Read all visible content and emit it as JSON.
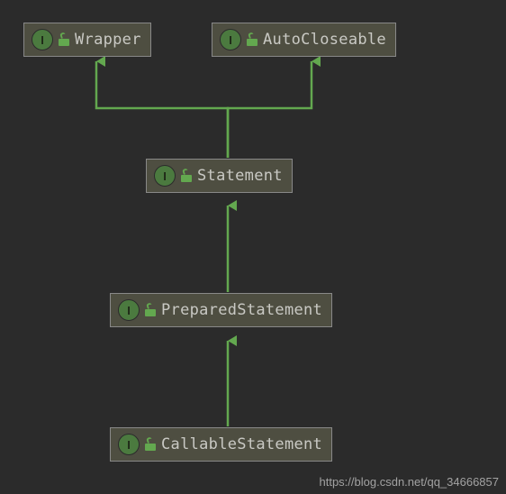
{
  "diagram": {
    "nodes": {
      "wrapper": {
        "label": "Wrapper",
        "badge": "I"
      },
      "autocloseable": {
        "label": "AutoCloseable",
        "badge": "I"
      },
      "statement": {
        "label": "Statement",
        "badge": "I"
      },
      "prepared": {
        "label": "PreparedStatement",
        "badge": "I"
      },
      "callable": {
        "label": "CallableStatement",
        "badge": "I"
      }
    },
    "edges": [
      {
        "from": "statement",
        "to": "wrapper"
      },
      {
        "from": "statement",
        "to": "autocloseable"
      },
      {
        "from": "prepared",
        "to": "statement"
      },
      {
        "from": "callable",
        "to": "prepared"
      }
    ]
  },
  "watermark": "https://blog.csdn.net/qq_34666857"
}
